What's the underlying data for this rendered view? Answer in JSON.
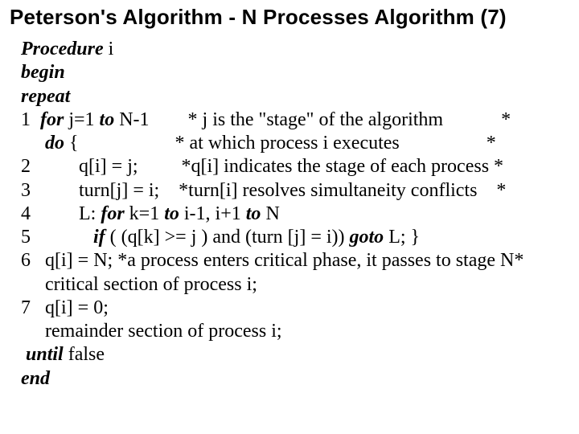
{
  "title": {
    "strong": "Peterson's Algorithm - ",
    "rest": "N Processes Algorithm (7)"
  },
  "code": {
    "l1a": "Procedure",
    "l1b": " i",
    "l2": "begin",
    "l3": "repeat",
    "l4a": "1  ",
    "l4b": "for",
    "l4c": " j=1 ",
    "l4d": "to",
    "l4e": " N-1        * j is the \"stage\" of the algorithm            *",
    "l5a": "     ",
    "l5b": "do",
    "l5c": " {                    * at which process i executes                  *",
    "l6": "2          q[i] = j;         *q[i] indicates the stage of each process *",
    "l7": "3          turn[j] = i;    *turn[i] resolves simultaneity conflicts    *",
    "l8a": "4          L: ",
    "l8b": "for",
    "l8c": " k=1 ",
    "l8d": "to",
    "l8e": " i-1, i+1 ",
    "l8f": "to",
    "l8g": " N",
    "l9a": "5             ",
    "l9b": "if",
    "l9c": " ( (q[k] >= j ) and (turn [j] = i)) ",
    "l9d": "goto",
    "l9e": " L; }",
    "l10": "6   q[i] = N; *a process enters critical phase, it passes to stage N*",
    "l11": "     critical section of process i;",
    "l12": "7   q[i] = 0;",
    "l13": "     remainder section of process i;",
    "l14": " until",
    "l14b": " false",
    "l15": "end"
  }
}
